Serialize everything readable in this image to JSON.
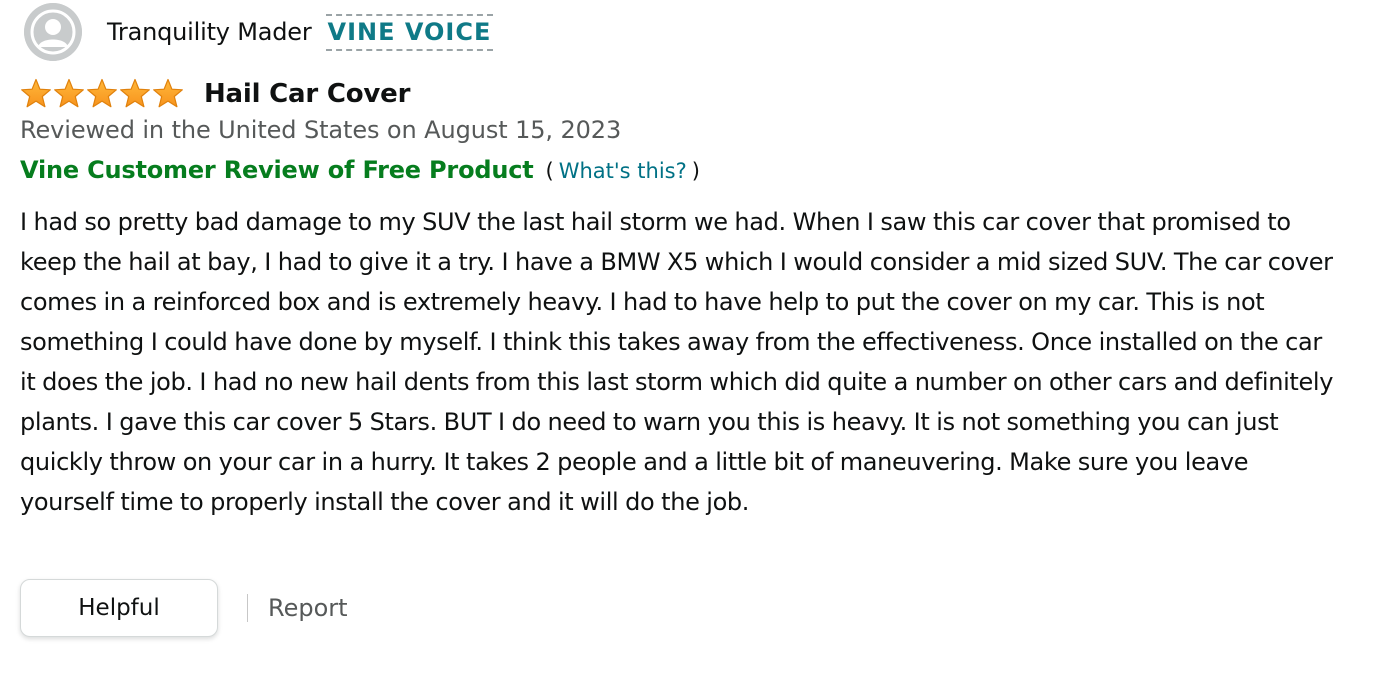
{
  "profile": {
    "name": "Tranquility Mader",
    "badge": "VINE VOICE",
    "avatar_icon": "person-silhouette-icon"
  },
  "review": {
    "rating": 5,
    "rating_max": 5,
    "star_color": "#ffa41c",
    "title": "Hail Car Cover",
    "date_line": "Reviewed in the United States on August 15, 2023",
    "vine_label": "Vine Customer Review of Free Product",
    "vine_paren_open": "(",
    "vine_whats_this": "What's this?",
    "vine_paren_close": ")",
    "body": "I had so pretty bad damage to my SUV the last hail storm we had. When I saw this car cover that promised to keep the hail at bay, I had to give it a try. I have a BMW X5 which I would consider a mid sized SUV. The car cover comes in a reinforced box and is extremely heavy. I had to have help to put the cover on my car. This is not something I could have done by myself. I think this takes away from the effectiveness. Once installed on the car it does the job. I had no new hail dents from this last storm which did quite a number on other cars and definitely plants. I gave this car cover 5 Stars. BUT I do need to warn you this is heavy. It is not something you can just quickly throw on your car in a hurry. It takes 2 people and a little bit of maneuvering. Make sure you leave yourself time to properly install the cover and it will do the job."
  },
  "actions": {
    "helpful_label": "Helpful",
    "report_label": "Report"
  },
  "colors": {
    "vine_badge": "#0f7a87",
    "vine_label": "#067d1e",
    "link": "#007185",
    "muted": "#565959"
  }
}
